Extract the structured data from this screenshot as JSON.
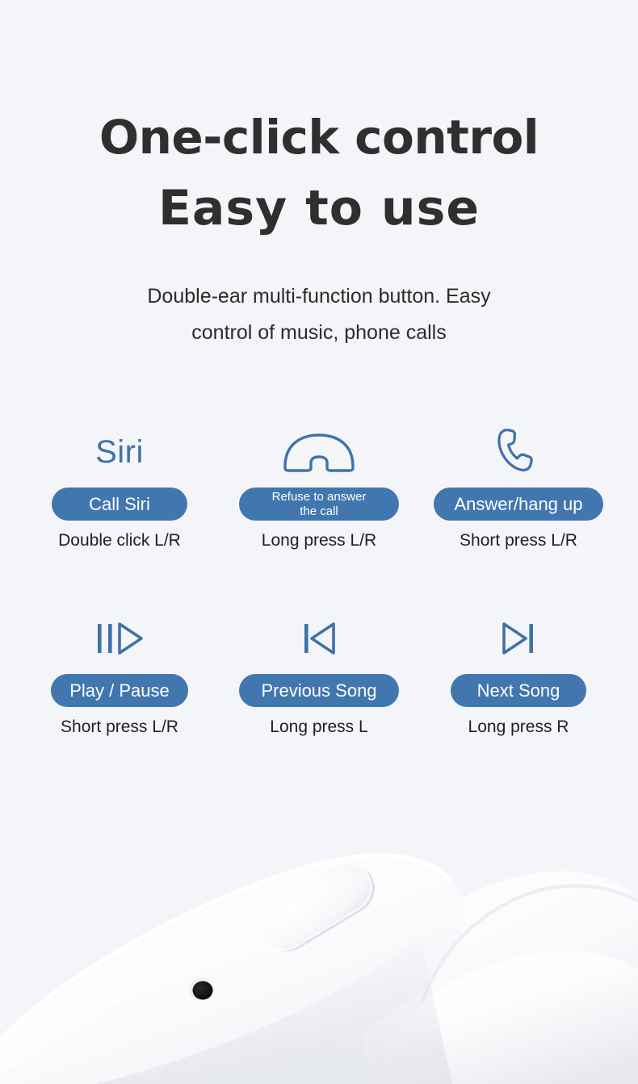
{
  "theme": {
    "background": "#f4f5f9",
    "accent_blue": "#4177ae",
    "icon_blue": "#3f72a8",
    "heading_color": "#2f2f2f",
    "caption_color": "#1f1f1f",
    "pill_text_color": "#ffffff"
  },
  "headline": {
    "line1": "One-click control",
    "line2": "Easy to use"
  },
  "subtitle": {
    "line1": "Double-ear multi-function button. Easy",
    "line2": "control of music, phone calls"
  },
  "controls": [
    {
      "icon": "siri-text-icon",
      "icon_text": "Siri",
      "button_label": "Call Siri",
      "button_label_line2": "",
      "caption": "Double click L/R"
    },
    {
      "icon": "hangup-handset-icon",
      "icon_text": "",
      "button_label": "Refuse to answer",
      "button_label_line2": "the call",
      "caption": "Long press L/R"
    },
    {
      "icon": "phone-handset-icon",
      "icon_text": "",
      "button_label": "Answer/hang up",
      "button_label_line2": "",
      "caption": "Short press L/R"
    },
    {
      "icon": "play-pause-icon",
      "icon_text": "",
      "button_label": "Play / Pause",
      "button_label_line2": "",
      "caption": "Short press L/R"
    },
    {
      "icon": "previous-track-icon",
      "icon_text": "",
      "button_label": "Previous Song",
      "button_label_line2": "",
      "caption": "Long press L"
    },
    {
      "icon": "next-track-icon",
      "icon_text": "",
      "button_label": "Next Song",
      "button_label_line2": "",
      "caption": "Long press R"
    }
  ],
  "photo": {
    "subject": "white-earbud-closeup",
    "parts": [
      "earbud-body",
      "multifunction-oval-button",
      "microphone-hole"
    ]
  }
}
